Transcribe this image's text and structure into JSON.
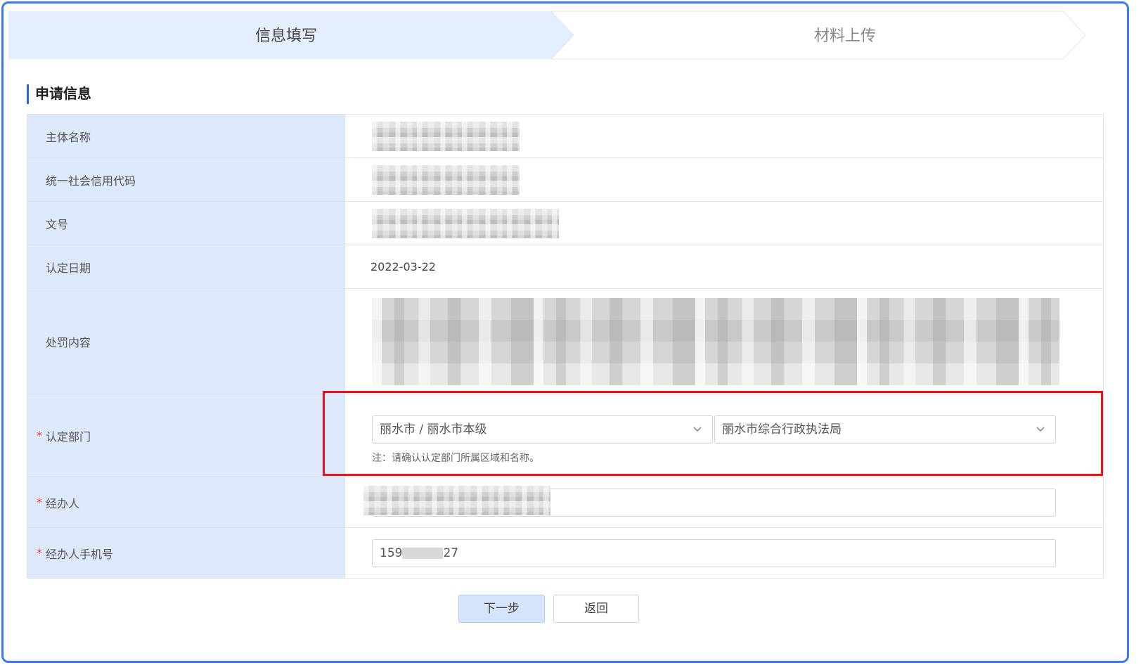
{
  "steps": [
    {
      "label": "信息填写",
      "active": true
    },
    {
      "label": "材料上传",
      "active": false
    }
  ],
  "section": {
    "title": "申请信息"
  },
  "form": {
    "subject_name": {
      "label": "主体名称"
    },
    "credit_code": {
      "label": "统一社会信用代码"
    },
    "doc_no": {
      "label": "文号"
    },
    "date": {
      "label": "认定日期",
      "value": "2022-03-22"
    },
    "penalty": {
      "label": "处罚内容"
    },
    "dept": {
      "required_mark": "*",
      "label": "认定部门",
      "region_value": "丽水市 / 丽水市本级",
      "org_value": "丽水市综合行政执法局",
      "note": "注：请确认认定部门所属区域和名称。"
    },
    "handler": {
      "required_mark": "*",
      "label": "经办人"
    },
    "phone": {
      "required_mark": "*",
      "label": "经办人手机号",
      "value_prefix": "159",
      "value_suffix": "27"
    }
  },
  "buttons": {
    "next": "下一步",
    "back": "返回"
  },
  "icons": {
    "dropdown": "chevron-down-icon"
  },
  "colors": {
    "accent": "#2d63d8",
    "label_bg": "#dde8fb",
    "highlight": "#e4161b",
    "frame": "#3a7cf0"
  }
}
